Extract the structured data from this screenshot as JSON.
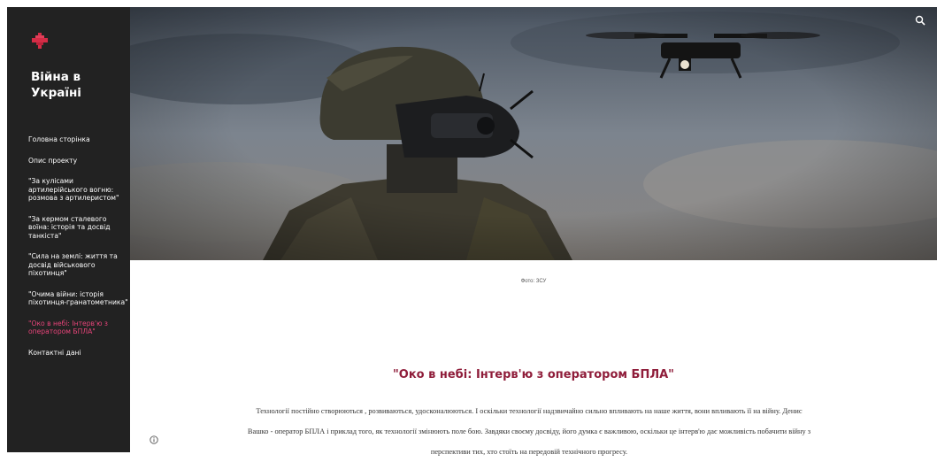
{
  "sidebar": {
    "logo_icon": "trident-cross-icon",
    "title": "Війна в Україні",
    "nav": [
      {
        "label": "Головна сторінка"
      },
      {
        "label": "Опис проекту"
      },
      {
        "label": "\"За кулісами артилерійського вогню: розмова з артилеристом\""
      },
      {
        "label": "\"За кермом сталевого воїна: історія та досвід танкіста\""
      },
      {
        "label": "\"Сила на землі: життя та досвід військового піхотинця\""
      },
      {
        "label": "\"Очима війни: історія піхотинця-гранатометника\""
      },
      {
        "label": "\"Око в небі: Інтерв'ю з оператором БПЛА\"",
        "active": true
      },
      {
        "label": "Контактні дані"
      }
    ],
    "active_color": "#e8447a"
  },
  "header": {
    "search_icon": "search-icon"
  },
  "hero": {
    "caption": "Фото: ЗСУ"
  },
  "article": {
    "title": "\"Око в небі: Інтерв'ю з оператором БПЛА\"",
    "title_color": "#8f1d3a",
    "body": "Технології постійно створюються , розвиваються, удосконалюються. І оскільки технології надзвичайно сильно впливають на наше життя, вони впливають її на війну. Денис Вашко - оператор БПЛА і приклад того, як технології змінюють поле бою. Завдяки своєму досвіду, його думка є важливою, оскільки це інтерв'ю дає можливість побачити війну з перспективи тих, хто стоїть на передовій технічного прогресу."
  },
  "footer": {
    "info_icon": "info-icon"
  }
}
